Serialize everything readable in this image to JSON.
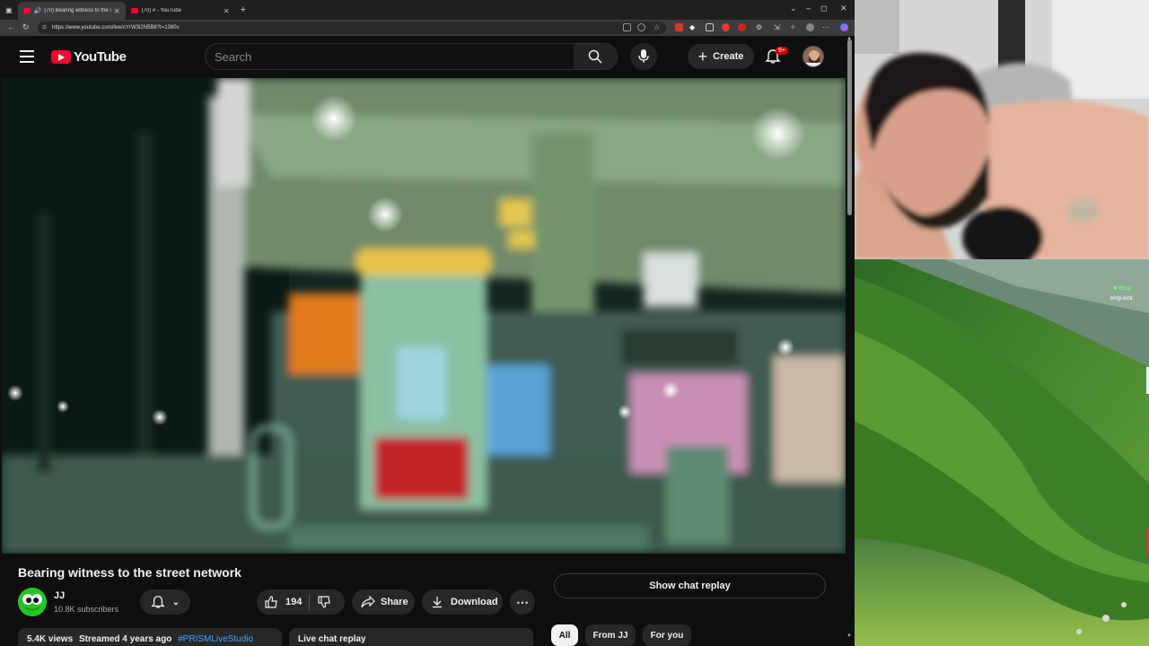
{
  "browser": {
    "tabs": [
      {
        "title": "(70) Bearing witness to the st",
        "active": true
      },
      {
        "title": "(70) # - YouTube",
        "active": false
      }
    ],
    "url": "https://www.youtube.com/live/cYrW3i2N5B8?t=1380s",
    "window_controls": {
      "minimize": "–",
      "maximize": "◻",
      "close": "✕"
    }
  },
  "header": {
    "logo_text": "YouTube",
    "search_placeholder": "Search",
    "create_label": "Create",
    "notification_count": "9+"
  },
  "video": {
    "title": "Bearing witness to the street network"
  },
  "channel": {
    "name": "JJ",
    "subscribers": "10.8K subscribers"
  },
  "actions": {
    "like_count": "194",
    "share_label": "Share",
    "download_label": "Download",
    "more_label": "⋯"
  },
  "chat": {
    "replay_button": "Show chat replay"
  },
  "description": {
    "views": "5.4K views",
    "streamed": "Streamed 4 years ago",
    "hashtag": "#PRISMLiveStudio"
  },
  "live_chat_replay_label": "Live chat replay",
  "chips": [
    {
      "label": "All",
      "selected": true
    },
    {
      "label": "From JJ",
      "selected": false
    },
    {
      "label": "For you",
      "selected": false
    }
  ],
  "overlay": {
    "stream_tag": "✖ Bingi",
    "stream_user": "bingi.kick"
  },
  "colors": {
    "background": "#0f0f0f",
    "brand_red": "#ff0033",
    "chip_selected": "#f1f1f1",
    "link_blue": "#3ea6ff"
  }
}
